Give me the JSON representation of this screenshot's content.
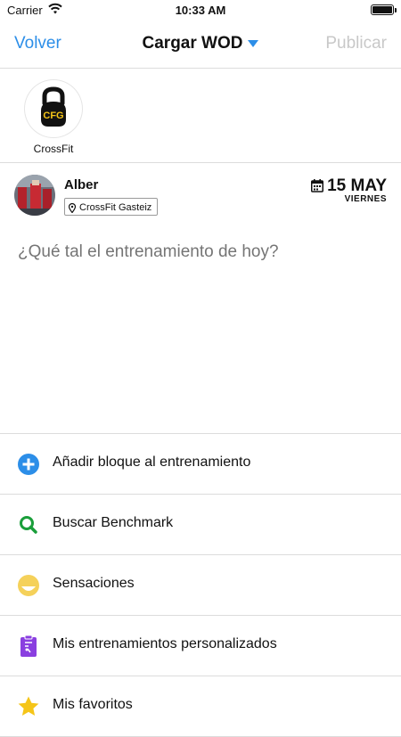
{
  "status_bar": {
    "carrier": "Carrier",
    "time": "10:33 AM"
  },
  "nav": {
    "back_label": "Volver",
    "title": "Cargar WOD",
    "publish_label": "Publicar"
  },
  "gym": {
    "name": "CrossFit",
    "logo_text": "CFG"
  },
  "post": {
    "user_name": "Alber",
    "location": "CrossFit Gasteiz",
    "date_day": "15 MAY",
    "date_weekday": "VIERNES",
    "placeholder": "¿Qué tal el entrenamiento de hoy?"
  },
  "menu": {
    "items": [
      {
        "label": "Añadir bloque al entrenamiento",
        "icon": "plus-circle-icon",
        "color": "#2c8ee8"
      },
      {
        "label": "Buscar Benchmark",
        "icon": "search-icon",
        "color": "#1a9e3a"
      },
      {
        "label": "Sensaciones",
        "icon": "face-icon",
        "color": "#f5d15a"
      },
      {
        "label": "Mis entrenamientos personalizados",
        "icon": "clipboard-icon",
        "color": "#8a3fe0"
      },
      {
        "label": "Mis favoritos",
        "icon": "star-icon",
        "color": "#f5c518"
      }
    ]
  },
  "colors": {
    "accent": "#2c8ee8",
    "disabled": "#c8c8c8",
    "divider": "#dcdcdc"
  }
}
